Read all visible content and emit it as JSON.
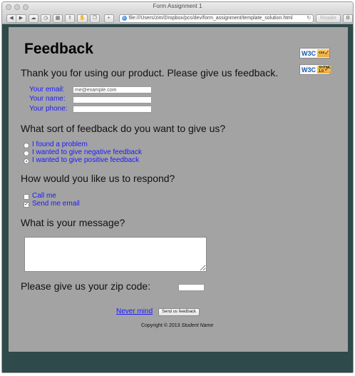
{
  "window": {
    "title": "Form Assignment 1"
  },
  "toolbar": {
    "url": "file:///Users/zim/Dropbox/pcs/dev/form_assignment/template_solution.html",
    "reader_label": "Reader"
  },
  "page": {
    "heading": "Feedback",
    "intro": "Thank you for using our product. Please give us feedback.",
    "badges": [
      {
        "logo": "W3C",
        "label": "css"
      },
      {
        "logo": "W3C",
        "label": "XHTML 1.0"
      }
    ],
    "contact": {
      "email_label": "Your email:",
      "email_value": "me@example.com",
      "name_label": "Your name:",
      "phone_label": "Your phone:"
    },
    "feedback_type": {
      "question": "What sort of feedback do you want to give us?",
      "options": [
        "I found a problem",
        "I wanted to give negative feedback",
        "I wanted to give positive feedback"
      ],
      "selected_index": 2
    },
    "respond": {
      "question": "How would you like us to respond?",
      "options": [
        {
          "label": "Call me",
          "checked": false
        },
        {
          "label": "Send me email",
          "checked": true
        }
      ]
    },
    "message": {
      "question": "What is your message?"
    },
    "zip": {
      "label": "Please give us your zip code:"
    },
    "actions": {
      "never_mind": "Never mind",
      "submit": "Send us feedback"
    },
    "footer": {
      "prefix": "Copyright © 2013",
      "name": "Student Name"
    }
  }
}
